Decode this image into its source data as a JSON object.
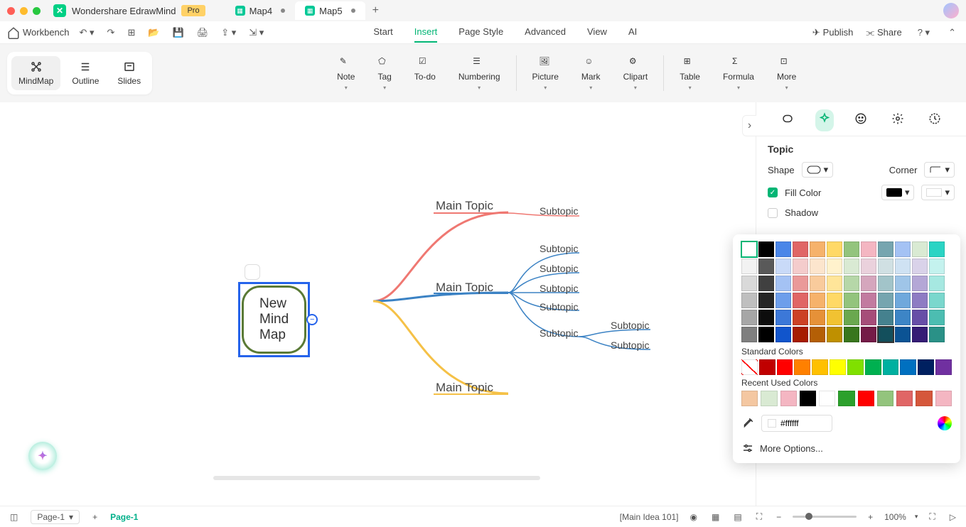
{
  "app": {
    "name": "Wondershare EdrawMind",
    "pro": "Pro"
  },
  "tabs": [
    {
      "label": "Map4",
      "active": false
    },
    {
      "label": "Map5",
      "active": true
    }
  ],
  "toolbar": {
    "workbench": "Workbench",
    "publish": "Publish",
    "share": "Share"
  },
  "menu": {
    "items": [
      "Start",
      "Insert",
      "Page Style",
      "Advanced",
      "View",
      "AI"
    ],
    "active": "Insert"
  },
  "view_modes": {
    "mindmap": "MindMap",
    "outline": "Outline",
    "slides": "Slides"
  },
  "ribbon": [
    {
      "label": "Note"
    },
    {
      "label": "Tag"
    },
    {
      "label": "To-do"
    },
    {
      "label": "Numbering"
    },
    {
      "label": "Picture"
    },
    {
      "label": "Mark"
    },
    {
      "label": "Clipart"
    },
    {
      "label": "Table"
    },
    {
      "label": "Formula"
    },
    {
      "label": "More"
    }
  ],
  "mindmap": {
    "central": "New Mind Map",
    "main_topics": [
      "Main Topic",
      "Main Topic",
      "Main Topic"
    ],
    "subtopic": "Subtopic"
  },
  "panel": {
    "title": "Topic",
    "shape": "Shape",
    "corner": "Corner",
    "fill_color": "Fill Color",
    "shadow": "Shadow"
  },
  "color_popup": {
    "standard_label": "Standard Colors",
    "recent_label": "Recent Used Colors",
    "hex": "#ffffff",
    "more": "More Options...",
    "theme_colors": [
      [
        "#ffffff",
        "#000000",
        "#4a86e8",
        "#e06666",
        "#f6b26b",
        "#ffd966",
        "#93c47d",
        "#f4b6c2",
        "#76a5af",
        "#a4c2f4",
        "#d9ead3",
        "#2bd4c4"
      ],
      [
        "#f2f2f2",
        "#595959",
        "#c9daf8",
        "#f4cccc",
        "#fce5cd",
        "#fff2cc",
        "#d9ead3",
        "#ead1dc",
        "#d0e0e3",
        "#cfe2f3",
        "#d9d2e9",
        "#c4f2ee"
      ],
      [
        "#d9d9d9",
        "#404040",
        "#a4c2f4",
        "#ea9999",
        "#f9cb9c",
        "#ffe599",
        "#b6d7a8",
        "#d5a6bd",
        "#a2c4c9",
        "#9fc5e8",
        "#b4a7d6",
        "#a6e8e1"
      ],
      [
        "#bfbfbf",
        "#262626",
        "#6d9eeb",
        "#e06666",
        "#f6b26b",
        "#ffd966",
        "#93c47d",
        "#c27ba0",
        "#76a5af",
        "#6fa8dc",
        "#8e7cc3",
        "#7ad7cd"
      ],
      [
        "#a6a6a6",
        "#0d0d0d",
        "#3c78d8",
        "#cc4125",
        "#e69138",
        "#f1c232",
        "#6aa84f",
        "#a64d79",
        "#45818e",
        "#3d85c6",
        "#674ea7",
        "#4cbdb1"
      ],
      [
        "#7f7f7f",
        "#000000",
        "#1155cc",
        "#a61c00",
        "#b45f06",
        "#bf9000",
        "#38761d",
        "#741b47",
        "#134f5c",
        "#0b5394",
        "#351c75",
        "#2a9187"
      ]
    ],
    "standard_colors": [
      "none",
      "#c00000",
      "#ff0000",
      "#ff8000",
      "#ffc000",
      "#ffff00",
      "#80e000",
      "#00b050",
      "#00b0a0",
      "#0070c0",
      "#002060",
      "#7030a0"
    ],
    "recent_colors": [
      "#f4c7a1",
      "#d9ead3",
      "#f4b6c2",
      "#000000",
      "#ffffff",
      "#2ca02c",
      "#ff0000",
      "#93c47d",
      "#e06666",
      "#d5573b",
      "#f4b6c2"
    ]
  },
  "status": {
    "page_selector": "Page-1",
    "page_active": "Page-1",
    "context": "[Main Idea 101]",
    "zoom": "100%"
  }
}
